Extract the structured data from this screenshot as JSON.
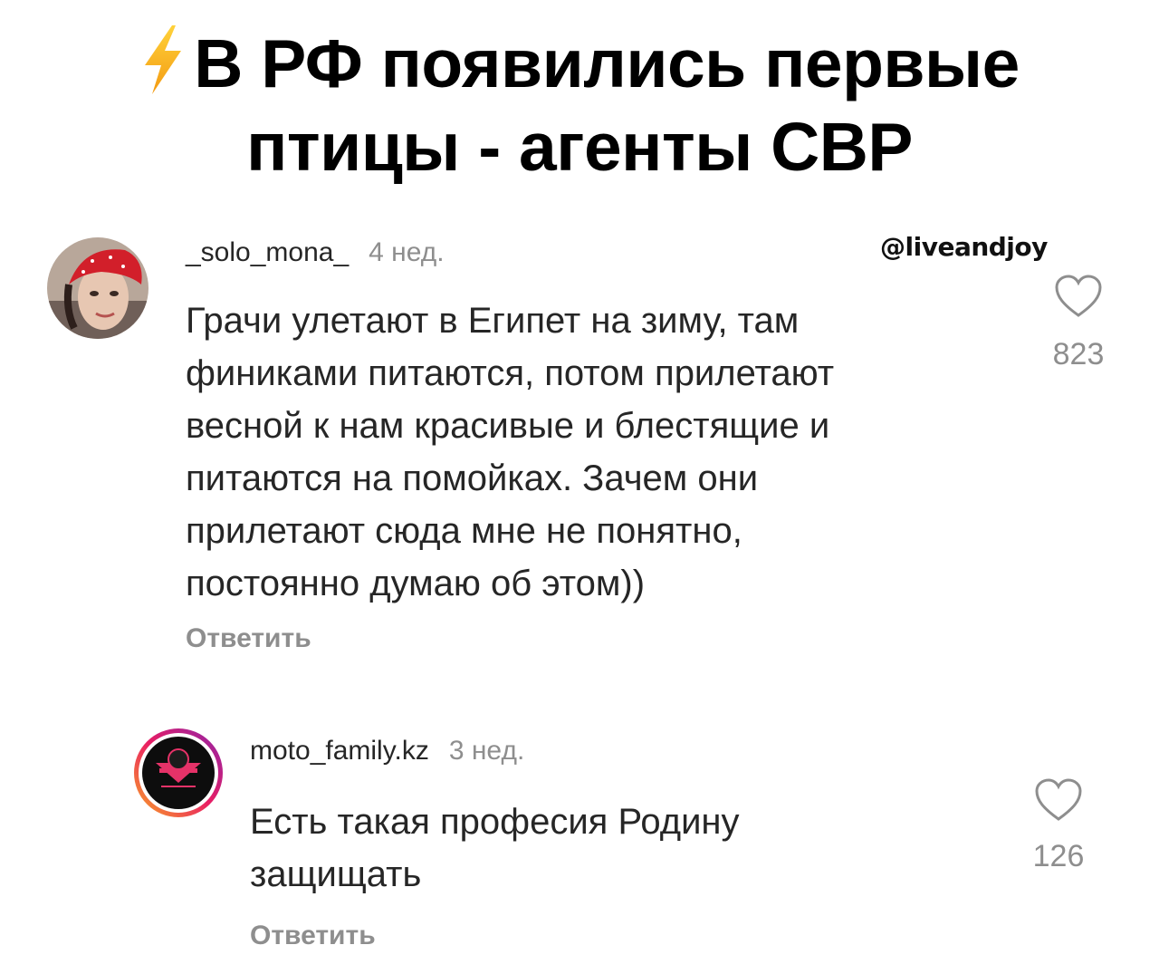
{
  "headline": {
    "line1": "В РФ появились первые",
    "line2": "птицы - агенты СВР",
    "icon": "lightning-bolt-emoji",
    "icon_color": "#f6b01b"
  },
  "watermark": "@liveandjoy",
  "comments": [
    {
      "username": "_solo_mona_",
      "time": "4 нед.",
      "text_lines": [
        "Грачи улетают в Египет на зиму, там",
        "финиками питаются, потом прилетают",
        "весной к нам красивые и блестящие и",
        "питаются на помойках.  Зачем они",
        "прилетают сюда мне не понятно,",
        "постоянно думаю об этом))"
      ],
      "reply_label": "Ответить",
      "likes": "823",
      "like_icon": "heart-outline-icon"
    },
    {
      "username": "moto_family.kz",
      "time": "3 нед.",
      "text_lines": [
        "Есть такая професия Родину",
        "защищать"
      ],
      "reply_label": "Ответить",
      "likes": "126",
      "like_icon": "heart-outline-icon"
    }
  ],
  "colors": {
    "text": "#262626",
    "secondary": "#8e8e8e",
    "bandana": "#d21f2a",
    "story_ring_start": "#f9a825",
    "story_ring_end": "#c2185b"
  }
}
